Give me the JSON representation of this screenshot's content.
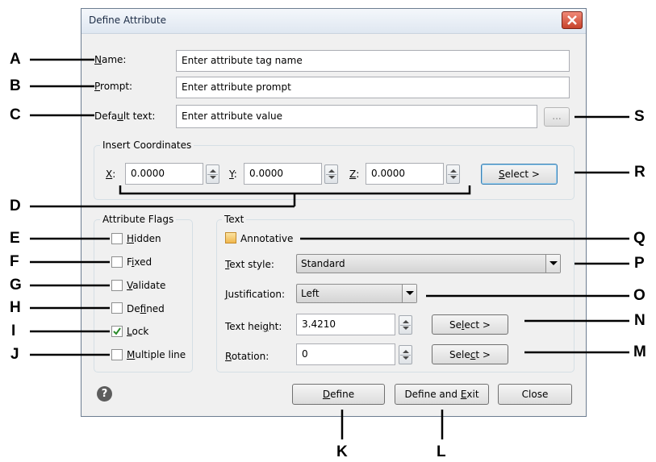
{
  "dialog": {
    "title": "Define Attribute",
    "name": {
      "label_pre": "",
      "label_ul": "N",
      "label_post": "ame:",
      "value": "Enter attribute tag name"
    },
    "prompt": {
      "label_pre": "",
      "label_ul": "P",
      "label_post": "rompt:",
      "value": "Enter attribute prompt"
    },
    "default_text": {
      "label_pre": "Defa",
      "label_ul": "u",
      "label_post": "lt text:",
      "value": "Enter attribute value",
      "browse_label": "..."
    },
    "insert_coordinates": {
      "group_title": "Insert Coordinates",
      "x": {
        "label_ul": "X",
        "label_post": ":",
        "value": "0.0000"
      },
      "y": {
        "label_ul": "Y",
        "label_post": ":",
        "value": "0.0000"
      },
      "z": {
        "label_ul": "Z",
        "label_post": ":",
        "value": "0.0000"
      },
      "select_pre": "",
      "select_ul": "S",
      "select_post": "elect  >"
    },
    "attribute_flags": {
      "group_title": "Attribute Flags",
      "items": [
        {
          "pre": "",
          "ul": "H",
          "post": "idden",
          "checked": false
        },
        {
          "pre": "F",
          "ul": "i",
          "post": "xed",
          "checked": false
        },
        {
          "pre": "",
          "ul": "V",
          "post": "alidate",
          "checked": false
        },
        {
          "pre": "De",
          "ul": "f",
          "post": "ined",
          "checked": false
        },
        {
          "pre": "",
          "ul": "L",
          "post": "ock",
          "checked": true
        },
        {
          "pre": "",
          "ul": "M",
          "post": "ultiple line",
          "checked": false
        }
      ]
    },
    "text": {
      "group_title": "Text",
      "annotative_label": "Annotative",
      "text_style": {
        "label_ul": "T",
        "label_post": "ext style:",
        "value": "Standard"
      },
      "justification": {
        "label_ul": "J",
        "label_post": "ustification:",
        "value": "Left"
      },
      "text_height": {
        "label_pre": "Text hei",
        "label_ul": "g",
        "label_post": "ht:",
        "value": "3.4210",
        "select_pre": "Se",
        "select_ul": "l",
        "select_post": "ect  >"
      },
      "rotation": {
        "label_ul": "R",
        "label_post": "otation:",
        "value": "0",
        "select_pre": "Sele",
        "select_ul": "c",
        "select_post": "t  >"
      }
    },
    "buttons": {
      "define": {
        "ul": "D",
        "post": "efine"
      },
      "define_exit": {
        "pre": "Define and ",
        "ul": "E",
        "post": "xit"
      },
      "close": "Close"
    },
    "help_icon": "question-circle-icon"
  },
  "callouts": [
    "A",
    "B",
    "C",
    "D",
    "E",
    "F",
    "G",
    "H",
    "I",
    "J",
    "K",
    "L",
    "M",
    "N",
    "O",
    "P",
    "Q",
    "R",
    "S"
  ]
}
